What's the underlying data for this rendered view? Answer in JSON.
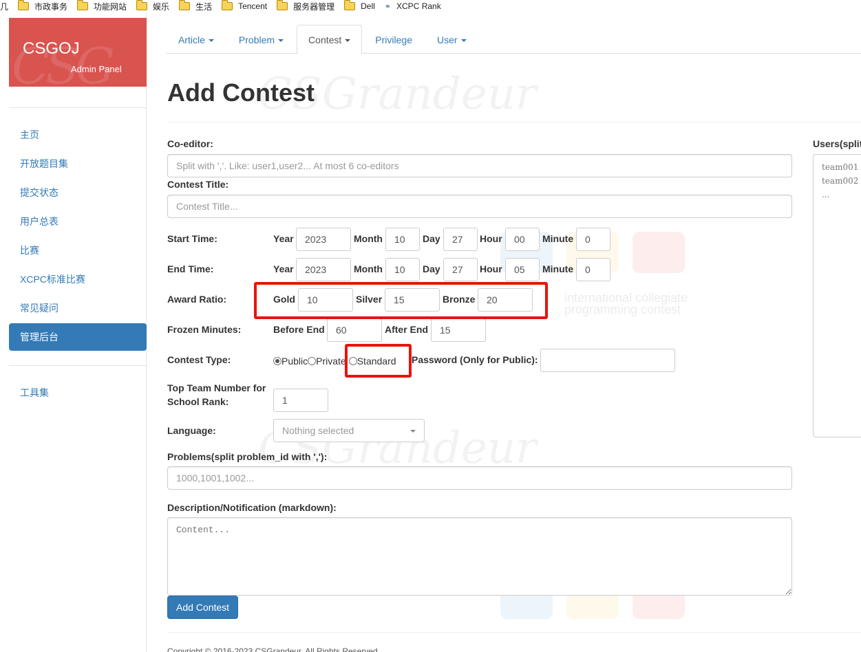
{
  "bookmarks": [
    {
      "label": "几",
      "icon": "none"
    },
    {
      "label": "市政事务",
      "icon": "folder-icon"
    },
    {
      "label": "功能网站",
      "icon": "folder-icon"
    },
    {
      "label": "娱乐",
      "icon": "folder-icon"
    },
    {
      "label": "生活",
      "icon": "folder-icon"
    },
    {
      "label": "Tencent",
      "icon": "folder-icon"
    },
    {
      "label": "服务器管理",
      "icon": "folder-icon"
    },
    {
      "label": "Dell",
      "icon": "folder-icon"
    },
    {
      "label": "XCPC Rank",
      "icon": "link-icon"
    }
  ],
  "brand": {
    "title": "CSGOJ",
    "subtitle": "Admin Panel",
    "color": "#d9534f"
  },
  "sidebar": {
    "items": [
      {
        "label": "主页"
      },
      {
        "label": "开放题目集"
      },
      {
        "label": "提交状态"
      },
      {
        "label": "用户总表"
      },
      {
        "label": "比赛"
      },
      {
        "label": "XCPC标准比赛"
      },
      {
        "label": "常见疑问"
      },
      {
        "label": "管理后台",
        "active": true
      }
    ],
    "tools": {
      "label": "工具集"
    }
  },
  "tabs": [
    {
      "label": "Article",
      "dropdown": true
    },
    {
      "label": "Problem",
      "dropdown": true
    },
    {
      "label": "Contest",
      "dropdown": true,
      "active": true
    },
    {
      "label": "Privilege",
      "dropdown": false
    },
    {
      "label": "User",
      "dropdown": true
    }
  ],
  "page": {
    "title": "Add Contest"
  },
  "form": {
    "coeditor": {
      "label": "Co-editor:",
      "placeholder": "Split with ','. Like: user1,user2... At most 6 co-editors"
    },
    "contest_title": {
      "label": "Contest Title:",
      "placeholder": "Contest Title..."
    },
    "time_labels": {
      "year": "Year",
      "month": "Month",
      "day": "Day",
      "hour": "Hour",
      "minute": "Minute"
    },
    "start_time": {
      "label": "Start Time:",
      "year": "2023",
      "month": "10",
      "day": "27",
      "hour": "00",
      "minute": "0"
    },
    "end_time": {
      "label": "End Time:",
      "year": "2023",
      "month": "10",
      "day": "27",
      "hour": "05",
      "minute": "0"
    },
    "award": {
      "label": "Award Ratio:",
      "gold_label": "Gold",
      "gold": "10",
      "silver_label": "Silver",
      "silver": "15",
      "bronze_label": "Bronze",
      "bronze": "20"
    },
    "frozen": {
      "label": "Frozen Minutes:",
      "before_label": "Before End",
      "before": "60",
      "after_label": "After End",
      "after": "15"
    },
    "contest_type": {
      "label": "Contest Type:",
      "options": [
        "Public",
        "Private",
        "Standard"
      ],
      "selected": "Public",
      "password_label": "Password (Only for Public):",
      "password": ""
    },
    "top_team": {
      "label_line1": "Top Team Number for",
      "label_line2": "School Rank:",
      "value": "1"
    },
    "language": {
      "label": "Language:",
      "value": "Nothing selected"
    },
    "problems": {
      "label": "Problems(split problem_id with ','):",
      "placeholder": "1000,1001,1002..."
    },
    "description": {
      "label": "Description/Notification (markdown):",
      "placeholder": "Content..."
    },
    "submit_label": "Add Contest"
  },
  "users_panel": {
    "label": "Users(split",
    "placeholder_lines": [
      "team001",
      "team002",
      "..."
    ]
  },
  "watermarks": {
    "text": "CSGrandeur",
    "icpc_line1": "international collegiate",
    "icpc_line2": "programming contest"
  },
  "footer": {
    "text": "Copyright © 2016-2023 CSGrandeur. All Rights Reserved."
  },
  "highlight_color": "#e8140c"
}
